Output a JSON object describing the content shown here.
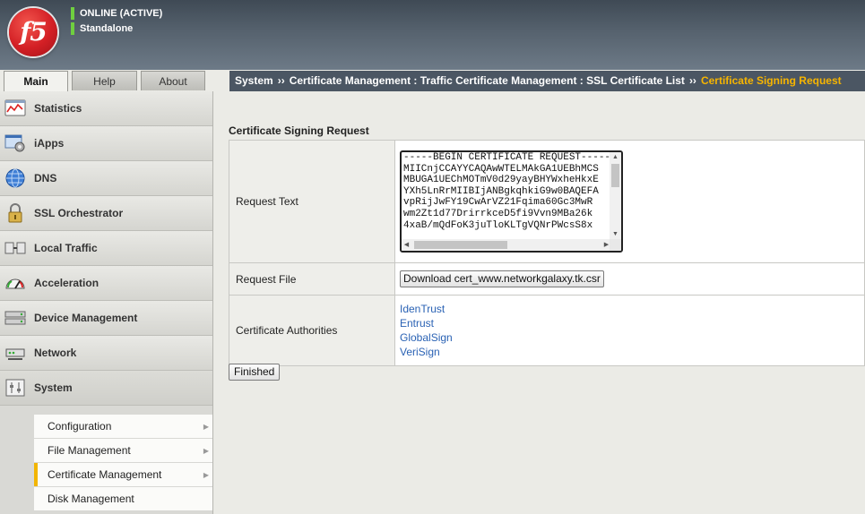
{
  "header": {
    "logo_text": "f5",
    "status": "ONLINE (ACTIVE)",
    "mode": "Standalone",
    "status_color": "#6fcf3f"
  },
  "tabs": [
    {
      "label": "Main",
      "active": true
    },
    {
      "label": "Help",
      "active": false
    },
    {
      "label": "About",
      "active": false
    }
  ],
  "breadcrumb": {
    "separator": "››",
    "items": [
      "System",
      "Certificate Management : Traffic Certificate Management : SSL Certificate List",
      "Certificate Signing Request"
    ],
    "current_color": "#f7b500"
  },
  "sidebar": {
    "items": [
      {
        "label": "Statistics",
        "icon": "statistics-icon"
      },
      {
        "label": "iApps",
        "icon": "iapps-icon"
      },
      {
        "label": "DNS",
        "icon": "dns-globe-icon"
      },
      {
        "label": "SSL Orchestrator",
        "icon": "lock-icon"
      },
      {
        "label": "Local Traffic",
        "icon": "local-traffic-icon"
      },
      {
        "label": "Acceleration",
        "icon": "gauge-icon"
      },
      {
        "label": "Device Management",
        "icon": "device-icon"
      },
      {
        "label": "Network",
        "icon": "network-icon"
      },
      {
        "label": "System",
        "icon": "system-icon"
      }
    ],
    "subitems": [
      {
        "label": "Configuration",
        "has_arrow": true
      },
      {
        "label": "File Management",
        "has_arrow": true
      },
      {
        "label": "Certificate Management",
        "has_arrow": true,
        "selected": true
      },
      {
        "label": "Disk Management",
        "has_arrow": false
      }
    ]
  },
  "main": {
    "section_title": "Certificate Signing Request",
    "request_text_label": "Request Text",
    "request_text": "-----BEGIN CERTIFICATE REQUEST-----\nMIICnjCCAYYCAQAwWTELMAkGA1UEBhMCS\nMBUGA1UEChMOTmV0d29yayBHYWxheHkxE\nYXh5LnRrMIIBIjANBgkqhkiG9w0BAQEFA\nvpRijJwFY19CwArVZ21Fqima60Gc3MwR\nwm2Zt1d77DrirrkceD5fi9Vvn9MBa26k\n4xaB/mQdFoK3juTloKLTgVQNrPWcsS8x",
    "request_file_label": "Request File",
    "download_button": "Download cert_www.networkgalaxy.tk.csr",
    "ca_label": "Certificate Authorities",
    "cas": [
      "IdenTrust",
      "Entrust",
      "GlobalSign",
      "VeriSign"
    ],
    "finished_button": "Finished"
  }
}
